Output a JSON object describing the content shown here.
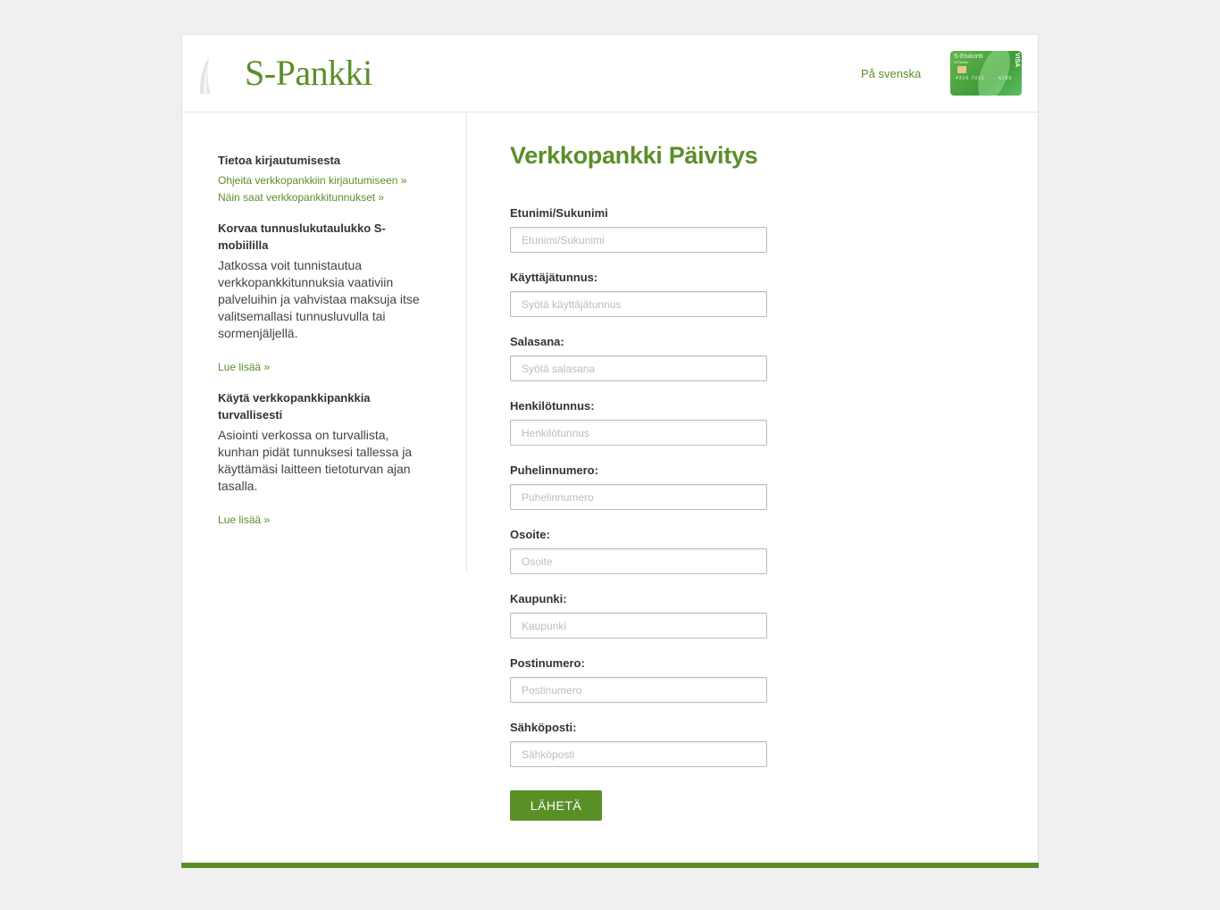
{
  "header": {
    "logo_text": "S-Pankki",
    "language_link": "På svenska",
    "card": {
      "name": "S-Etukortti",
      "issuer": "S-Pankki",
      "number": "4316 7031 ···· 6789",
      "network": "VISA"
    }
  },
  "sidebar": {
    "sections": [
      {
        "heading": "Tietoa kirjautumisesta",
        "links": [
          "Ohjeita verkkopankkiin kirjautumiseen »",
          "Näin saat verkkopankkitunnukset »"
        ]
      },
      {
        "heading": "Korvaa tunnuslukutaulukko S-mobiililla",
        "text": "Jatkossa voit tunnistautua verkkopankkitunnuksia vaativiin palveluihin ja vahvistaa maksuja itse valitsemallasi tunnusluvulla tai sormenjäljellä.",
        "link": "Lue lisää »"
      },
      {
        "heading": "Käytä verkkopankkipankkia turvallisesti",
        "text": "Asiointi verkossa on turvallista, kunhan pidät tunnuksesi tallessa ja käyttämäsi laitteen tietoturvan ajan tasalla.",
        "link": "Lue lisää »"
      }
    ]
  },
  "main": {
    "title": "Verkkopankki Päivitys",
    "fields": [
      {
        "label": "Etunimi/Sukunimi",
        "placeholder": "Etunimi/Sukunimi",
        "value": ""
      },
      {
        "label": "Käyttäjätunnus:",
        "placeholder": "Syötä käyttäjätunnus",
        "value": ""
      },
      {
        "label": "Salasana:",
        "placeholder": "Syötä salasana",
        "value": ""
      },
      {
        "label": "Henkilötunnus:",
        "placeholder": "Henkilötunnus",
        "value": ""
      },
      {
        "label": "Puhelinnumero:",
        "placeholder": "Puhelinnumero",
        "value": ""
      },
      {
        "label": "Osoite:",
        "placeholder": "Osoite",
        "value": ""
      },
      {
        "label": "Kaupunki:",
        "placeholder": "Kaupunki",
        "value": ""
      },
      {
        "label": "Postinumero:",
        "placeholder": "Postinumero",
        "value": ""
      },
      {
        "label": "Sähköposti:",
        "placeholder": "Sähköposti",
        "value": ""
      }
    ],
    "submit_label": "LÄHETÄ"
  },
  "colors": {
    "brand_green": "#5a8f28",
    "background": "#f0f0f0"
  }
}
